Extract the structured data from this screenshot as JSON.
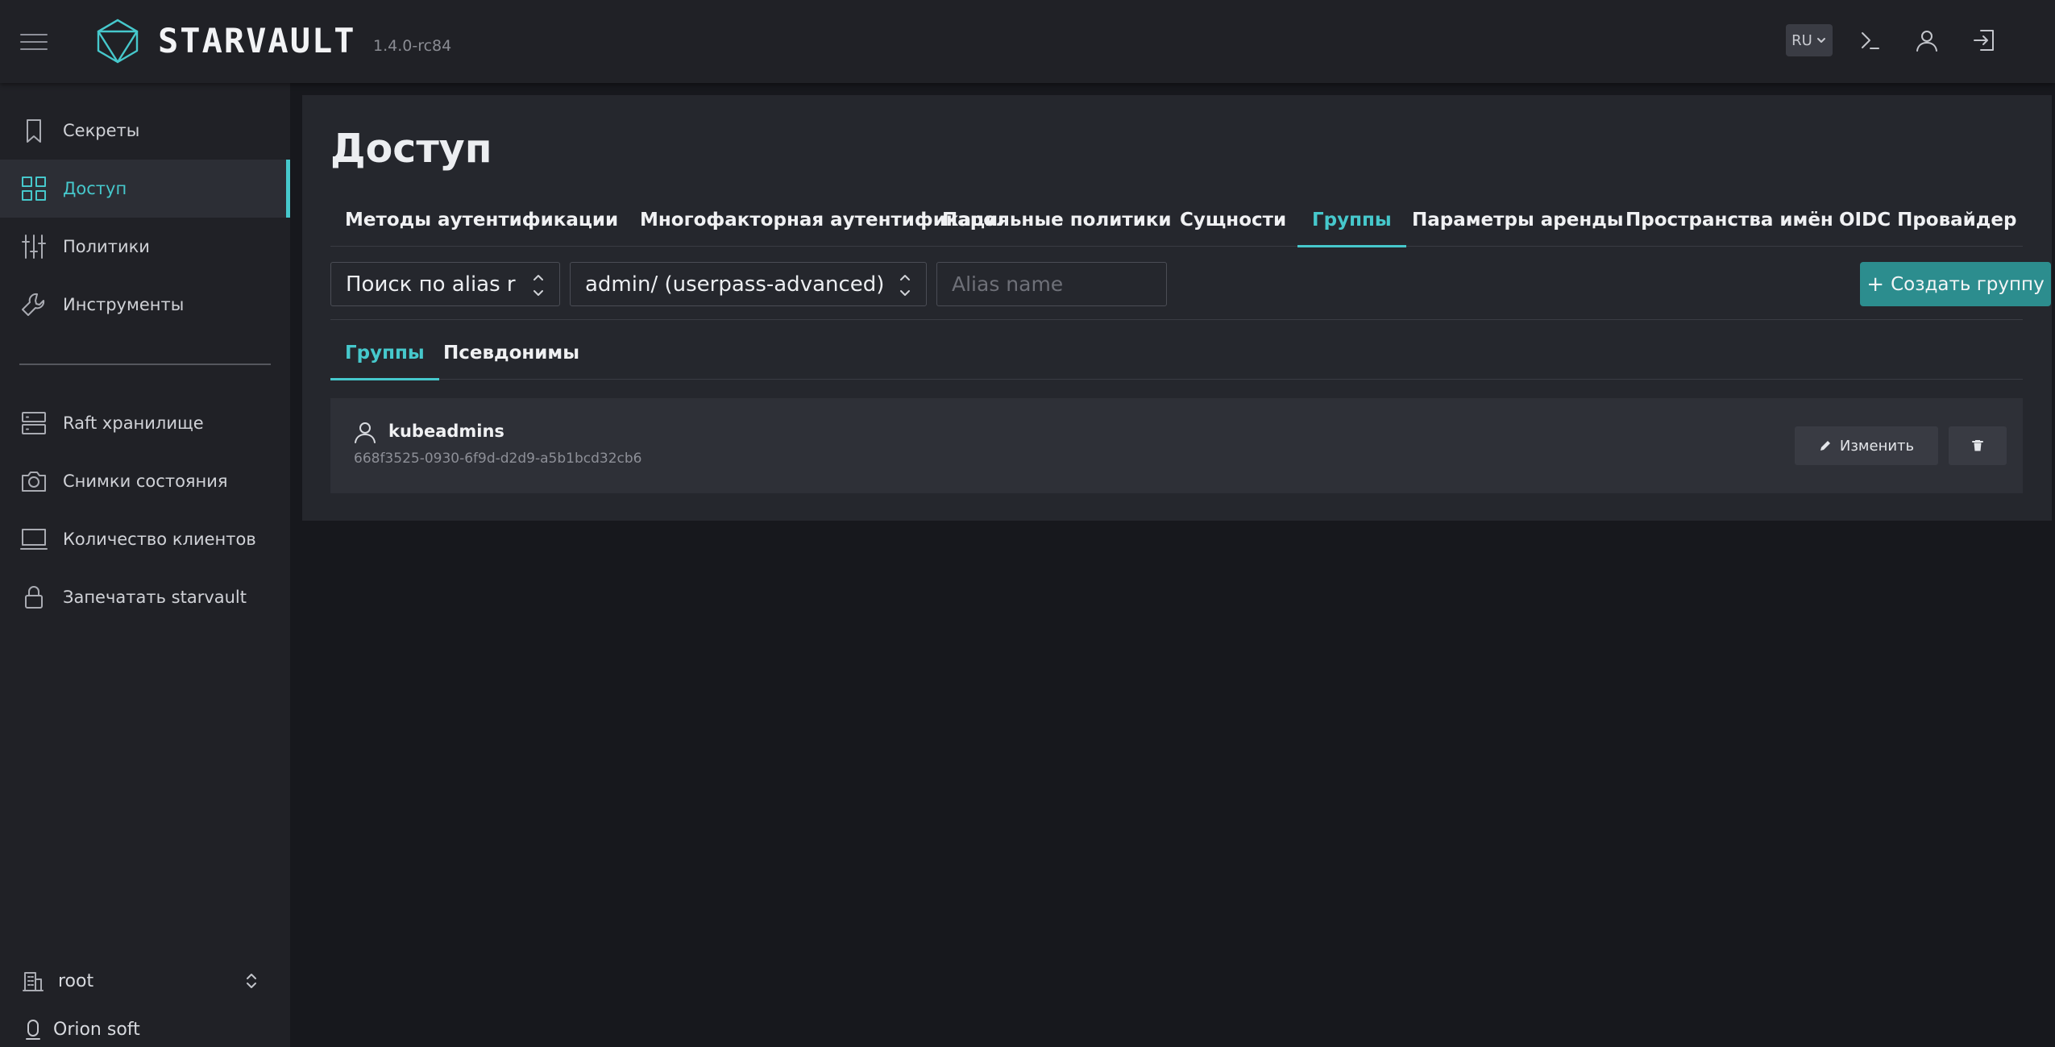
{
  "header": {
    "logo_text": "STARVAULT",
    "version": "1.4.0-rc84",
    "language": "RU",
    "icons": [
      "menu-icon",
      "logo-icon",
      "terminal-icon",
      "user-icon",
      "logout-icon"
    ]
  },
  "sidebar": {
    "items": [
      {
        "label": "Секреты",
        "icon": "bookmark-icon"
      },
      {
        "label": "Доступ",
        "icon": "grid-icon",
        "active": true
      },
      {
        "label": "Политики",
        "icon": "sliders-icon"
      },
      {
        "label": "Инструменты",
        "icon": "wrench-icon"
      },
      {
        "label": "Raft хранилище",
        "icon": "server-icon"
      },
      {
        "label": "Снимки состояния",
        "icon": "camera-icon"
      },
      {
        "label": "Количество клиентов",
        "icon": "laptop-icon"
      },
      {
        "label": "Запечатать starvault",
        "icon": "lock-icon"
      }
    ],
    "namespace": "root",
    "vendor": "Orion soft"
  },
  "main": {
    "title": "Доступ",
    "tabs": [
      {
        "label": "Методы аутентификации"
      },
      {
        "label": "Многофакторная аутентификация"
      },
      {
        "label": "Парольные политики"
      },
      {
        "label": "Сущности"
      },
      {
        "label": "Группы",
        "active": true
      },
      {
        "label": "Параметры аренды"
      },
      {
        "label": "Пространства имён"
      },
      {
        "label": "OIDC Провайдер"
      }
    ],
    "filters": {
      "search_type": "Поиск по alias r",
      "mount": "admin/ (userpass-advanced)",
      "alias_placeholder": "Alias name"
    },
    "create_button": "Создать группу",
    "subtabs": [
      {
        "label": "Группы",
        "active": true
      },
      {
        "label": "Псевдонимы"
      }
    ],
    "groups": [
      {
        "name": "kubeadmins",
        "id": "668f3525-0930-6f9d-d2d9-a5b1bcd32cb6"
      }
    ],
    "edit_button": "Изменить"
  },
  "colors": {
    "accent": "#46c8cc",
    "button_primary": "#2c8d8e",
    "background": "#17181d",
    "panel": "#25272d"
  }
}
